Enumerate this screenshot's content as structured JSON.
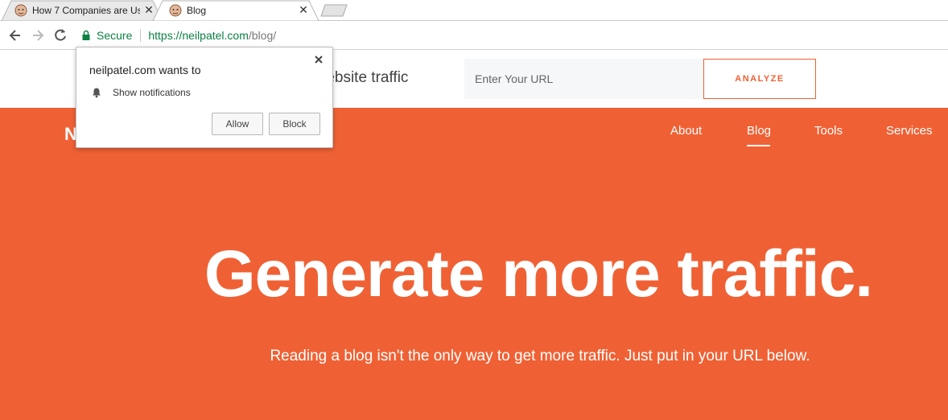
{
  "browser": {
    "tabs": [
      {
        "title": "How 7 Companies are Us",
        "active": false,
        "favicon": "neil-patel-face-icon"
      },
      {
        "title": "Blog",
        "active": true,
        "favicon": "neil-patel-face-icon"
      }
    ],
    "toolbar": {
      "back_icon": "arrow-left-icon",
      "forward_icon": "arrow-right-icon",
      "reload_icon": "reload-icon"
    },
    "omnibox": {
      "secure_label": "Secure",
      "url_base": "https://neilpatel.com",
      "url_path": "/blog/"
    }
  },
  "header": {
    "tagline_partial": "r website traffic",
    "url_input_placeholder": "Enter Your URL",
    "analyze_label": "ANALYZE"
  },
  "nav": {
    "logo_partial": "N",
    "items": [
      {
        "label": "About"
      },
      {
        "label": "Blog",
        "active": true
      },
      {
        "label": "Tools"
      },
      {
        "label": "Services"
      }
    ]
  },
  "hero": {
    "headline": "Generate more traffic.",
    "subline": "Reading a blog isn't the only way to get more traffic. Just put in your URL below."
  },
  "popup": {
    "title": "neilpatel.com wants to",
    "permission": "Show notifications",
    "allow_label": "Allow",
    "block_label": "Block"
  },
  "colors": {
    "brand_orange": "#ef6134",
    "secure_green": "#0b8043"
  }
}
